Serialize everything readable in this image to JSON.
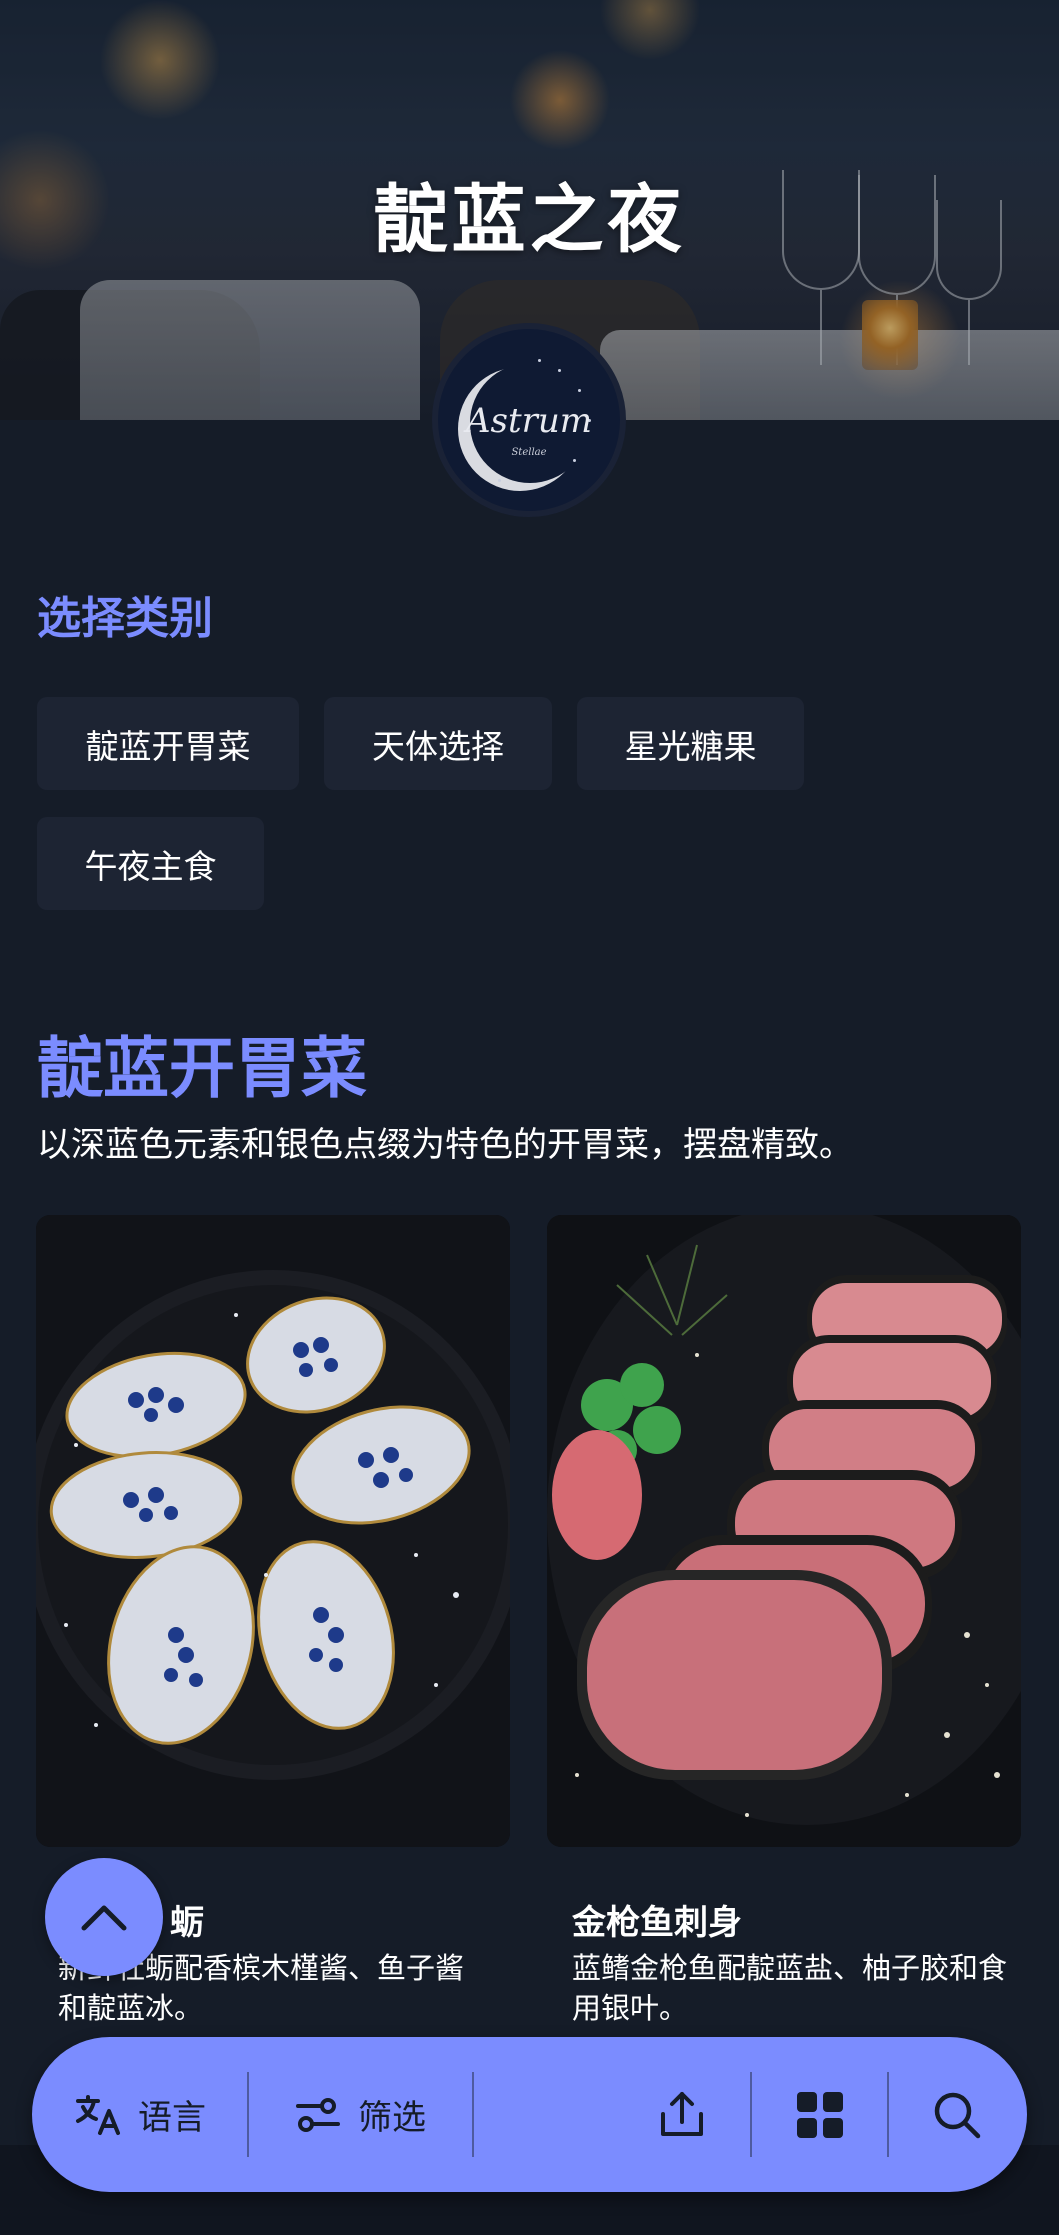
{
  "hero": {
    "title": "靛蓝之夜"
  },
  "logo": {
    "name": "Astrum",
    "subtitle": "Stellae"
  },
  "categories": {
    "label": "选择类别",
    "items": [
      "靛蓝开胃菜",
      "天体选择",
      "星光糖果",
      "午夜主食"
    ]
  },
  "section": {
    "title": "靛蓝开胃菜",
    "description": "以深蓝色元素和银色点缀为特色的开胃菜，摆盘精致。"
  },
  "dishes": [
    {
      "name": "蛎",
      "description": "新鲜牡蛎配香槟木槿酱、鱼子酱和靛蓝冰。"
    },
    {
      "name": "金枪鱼刺身",
      "description": "蓝鳍金枪鱼配靛蓝盐、柚子胶和食用银叶。"
    }
  ],
  "toolbar": {
    "language_label": "语言",
    "filter_label": "筛选",
    "icons": [
      "translate-icon",
      "filter-icon",
      "share-icon",
      "grid-icon",
      "search-icon"
    ]
  },
  "colors": {
    "accent": "#7b8cff",
    "background": "#151c28",
    "chip": "#1d2433"
  }
}
